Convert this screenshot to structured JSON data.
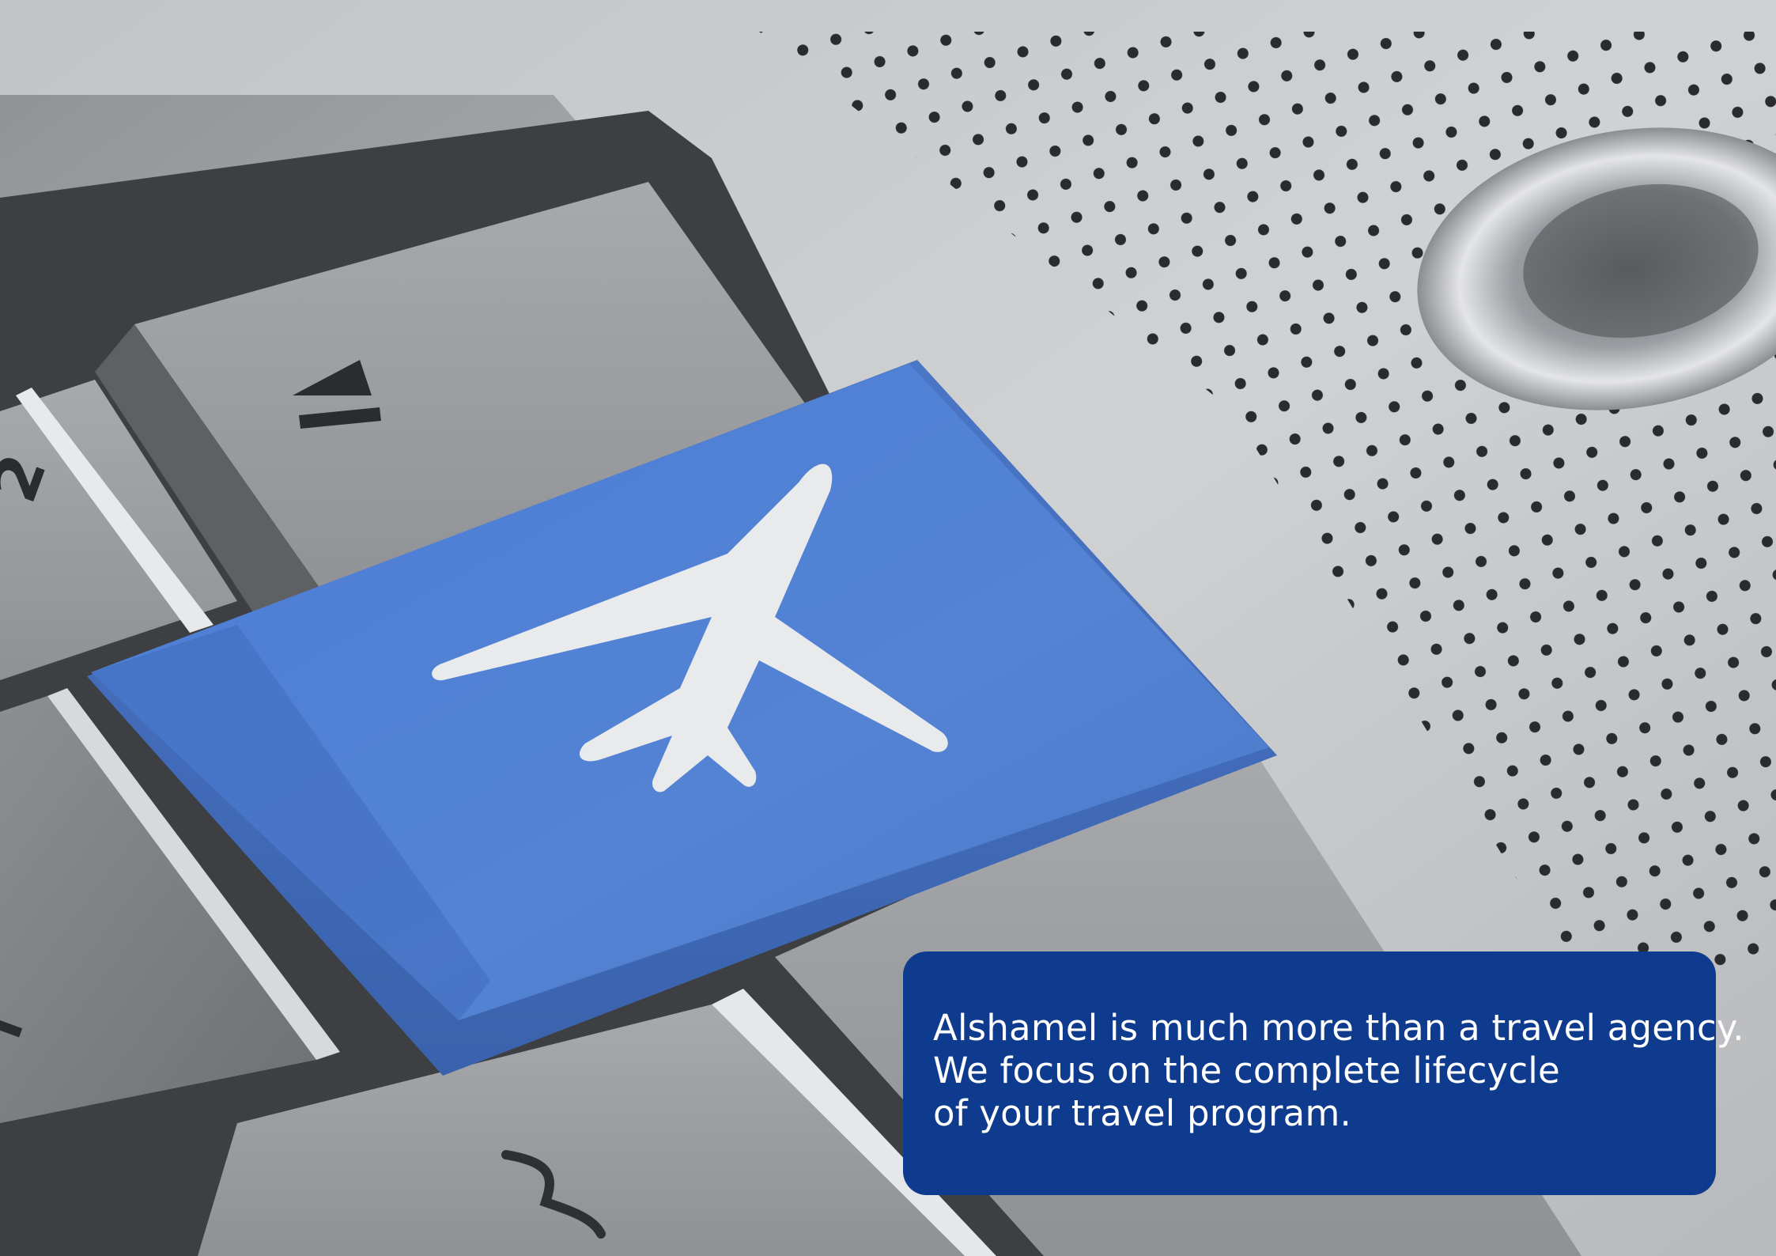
{
  "image": {
    "scene": "laptop keyboard close-up with a blue airplane key",
    "key_symbols": {
      "number_key_glyph": "2",
      "eject_key_icon": "eject-icon",
      "travel_key_icon": "airplane-icon"
    },
    "colors": {
      "key_blue": "#4f7fd2",
      "panel_blue": "#0f3b8e",
      "aluminum": "#b9bbbe",
      "text": "#ffffff"
    }
  },
  "caption": {
    "lines": [
      "Alshamel is much more than a travel agency.",
      "We focus on the complete lifecycle",
      "of your travel program."
    ]
  }
}
